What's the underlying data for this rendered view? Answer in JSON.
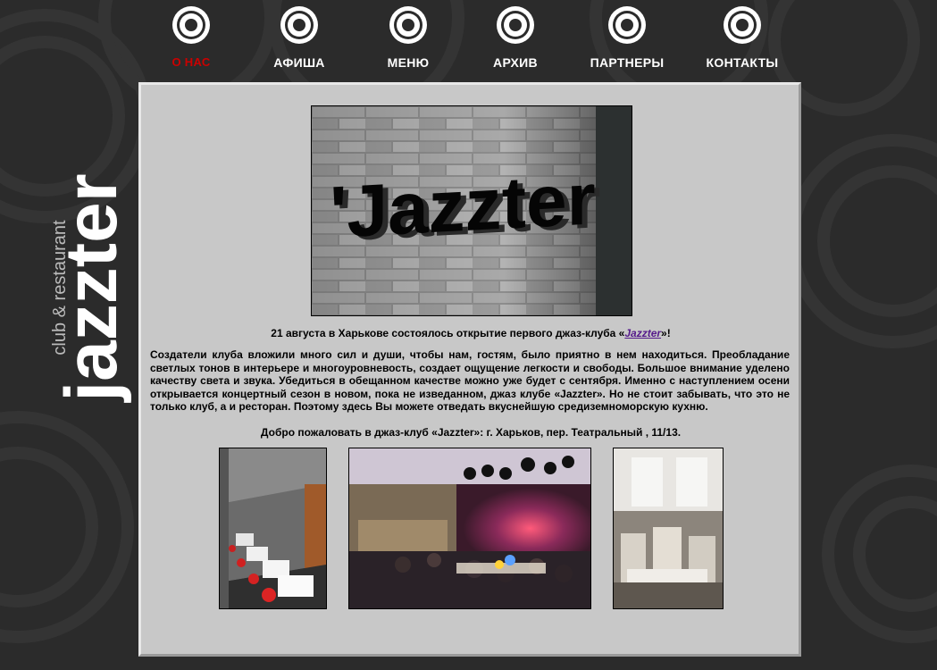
{
  "brand": {
    "name": "jazzter",
    "tagline": "club & restaurant"
  },
  "nav": {
    "items": [
      {
        "label": "О НАС",
        "active": true
      },
      {
        "label": "АФИША",
        "active": false
      },
      {
        "label": "МЕНЮ",
        "active": false
      },
      {
        "label": "АРХИВ",
        "active": false
      },
      {
        "label": "ПАРТНЕРЫ",
        "active": false
      },
      {
        "label": "КОНТАКТЫ",
        "active": false
      }
    ],
    "active_color": "#cc0000"
  },
  "hero": {
    "sign_text": "'Jazzter"
  },
  "content": {
    "headline_before": "21 августа в Харькове состоялось открытие первого джаз-клуба «",
    "headline_link": "Jazzter",
    "headline_after": "»!",
    "body": "Создатели клуба вложили много сил и души, чтобы нам, гостям, было приятно в нем находиться. Преобладание светлых тонов в интерьере и многоуровневость, создает ощущение легкости и свободы. Большое внимание уделено качеству света и звука. Убедиться в обещанном качестве можно уже будет с сентября. Именно с наступлением осени открывается концертный сезон в новом, пока не изведанном, джаз клубе «Jazzter». Но не стоит забывать, что это не только клуб, а и ресторан. Поэтому здесь Вы можете отведать вкуснейшую средиземноморскую кухню.",
    "welcome": "Добро пожаловать в джаз-клуб «Jazzter»: г. Харьков, пер. Театральный , 11/13."
  },
  "colors": {
    "background": "#2b2b2b",
    "panel": "#c8c8c8",
    "link": "#551a8b"
  }
}
